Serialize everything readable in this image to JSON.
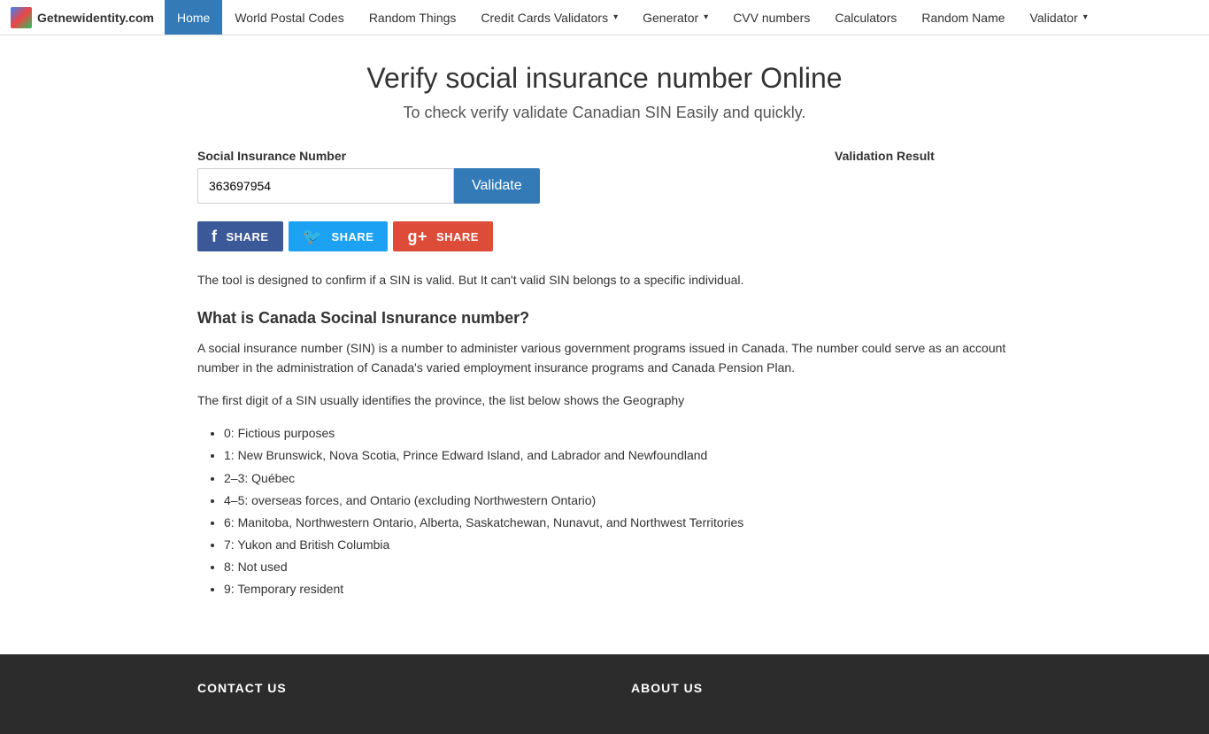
{
  "site": {
    "brand_name": "Getnewidentity.com",
    "brand_icon_alt": "site-logo"
  },
  "navbar": {
    "items": [
      {
        "label": "Home",
        "active": true,
        "has_dropdown": false
      },
      {
        "label": "World Postal Codes",
        "active": false,
        "has_dropdown": false
      },
      {
        "label": "Random Things",
        "active": false,
        "has_dropdown": false
      },
      {
        "label": "Credit Cards Validators",
        "active": false,
        "has_dropdown": true
      },
      {
        "label": "Generator",
        "active": false,
        "has_dropdown": true
      },
      {
        "label": "CVV numbers",
        "active": false,
        "has_dropdown": false
      },
      {
        "label": "Calculators",
        "active": false,
        "has_dropdown": false
      },
      {
        "label": "Random Name",
        "active": false,
        "has_dropdown": false
      },
      {
        "label": "Validator",
        "active": false,
        "has_dropdown": true
      }
    ]
  },
  "page": {
    "title": "Verify social insurance number Online",
    "subtitle": "To check verify validate Canadian SIN Easily and quickly.",
    "sin_label": "Social Insurance Number",
    "sin_value": "363697954",
    "sin_placeholder": "363697954",
    "validate_button": "Validate",
    "validation_result_label": "Validation Result"
  },
  "social": {
    "facebook_label": "SHARE",
    "twitter_label": "SHARE",
    "google_label": "SHARE"
  },
  "content": {
    "tool_desc": "The tool is designed to confirm if a SIN is valid. But It can't valid SIN belongs to a specific individual.",
    "what_is_heading": "What is Canada Socinal Isnurance number?",
    "what_is_p1": "A social insurance number (SIN) is a number to administer various government programs issued in Canada. The number could serve as an account number in the administration of Canada's varied employment insurance programs and Canada Pension Plan.",
    "what_is_p2": "The first digit of a SIN usually identifies the province, the list below shows the Geography",
    "province_list": [
      "0: Fictious purposes",
      "1: New Brunswick, Nova Scotia, Prince Edward Island, and Labrador and Newfoundland",
      "2–3: Québec",
      "4–5: overseas forces, and Ontario (excluding Northwestern Ontario)",
      "6: Manitoba, Northwestern Ontario, Alberta, Saskatchewan, Nunavut, and Northwest Territories",
      "7: Yukon and British Columbia",
      "8: Not used",
      "9: Temporary resident"
    ]
  },
  "footer": {
    "contact_heading": "CONTACT US",
    "about_heading": "ABOUT US"
  }
}
